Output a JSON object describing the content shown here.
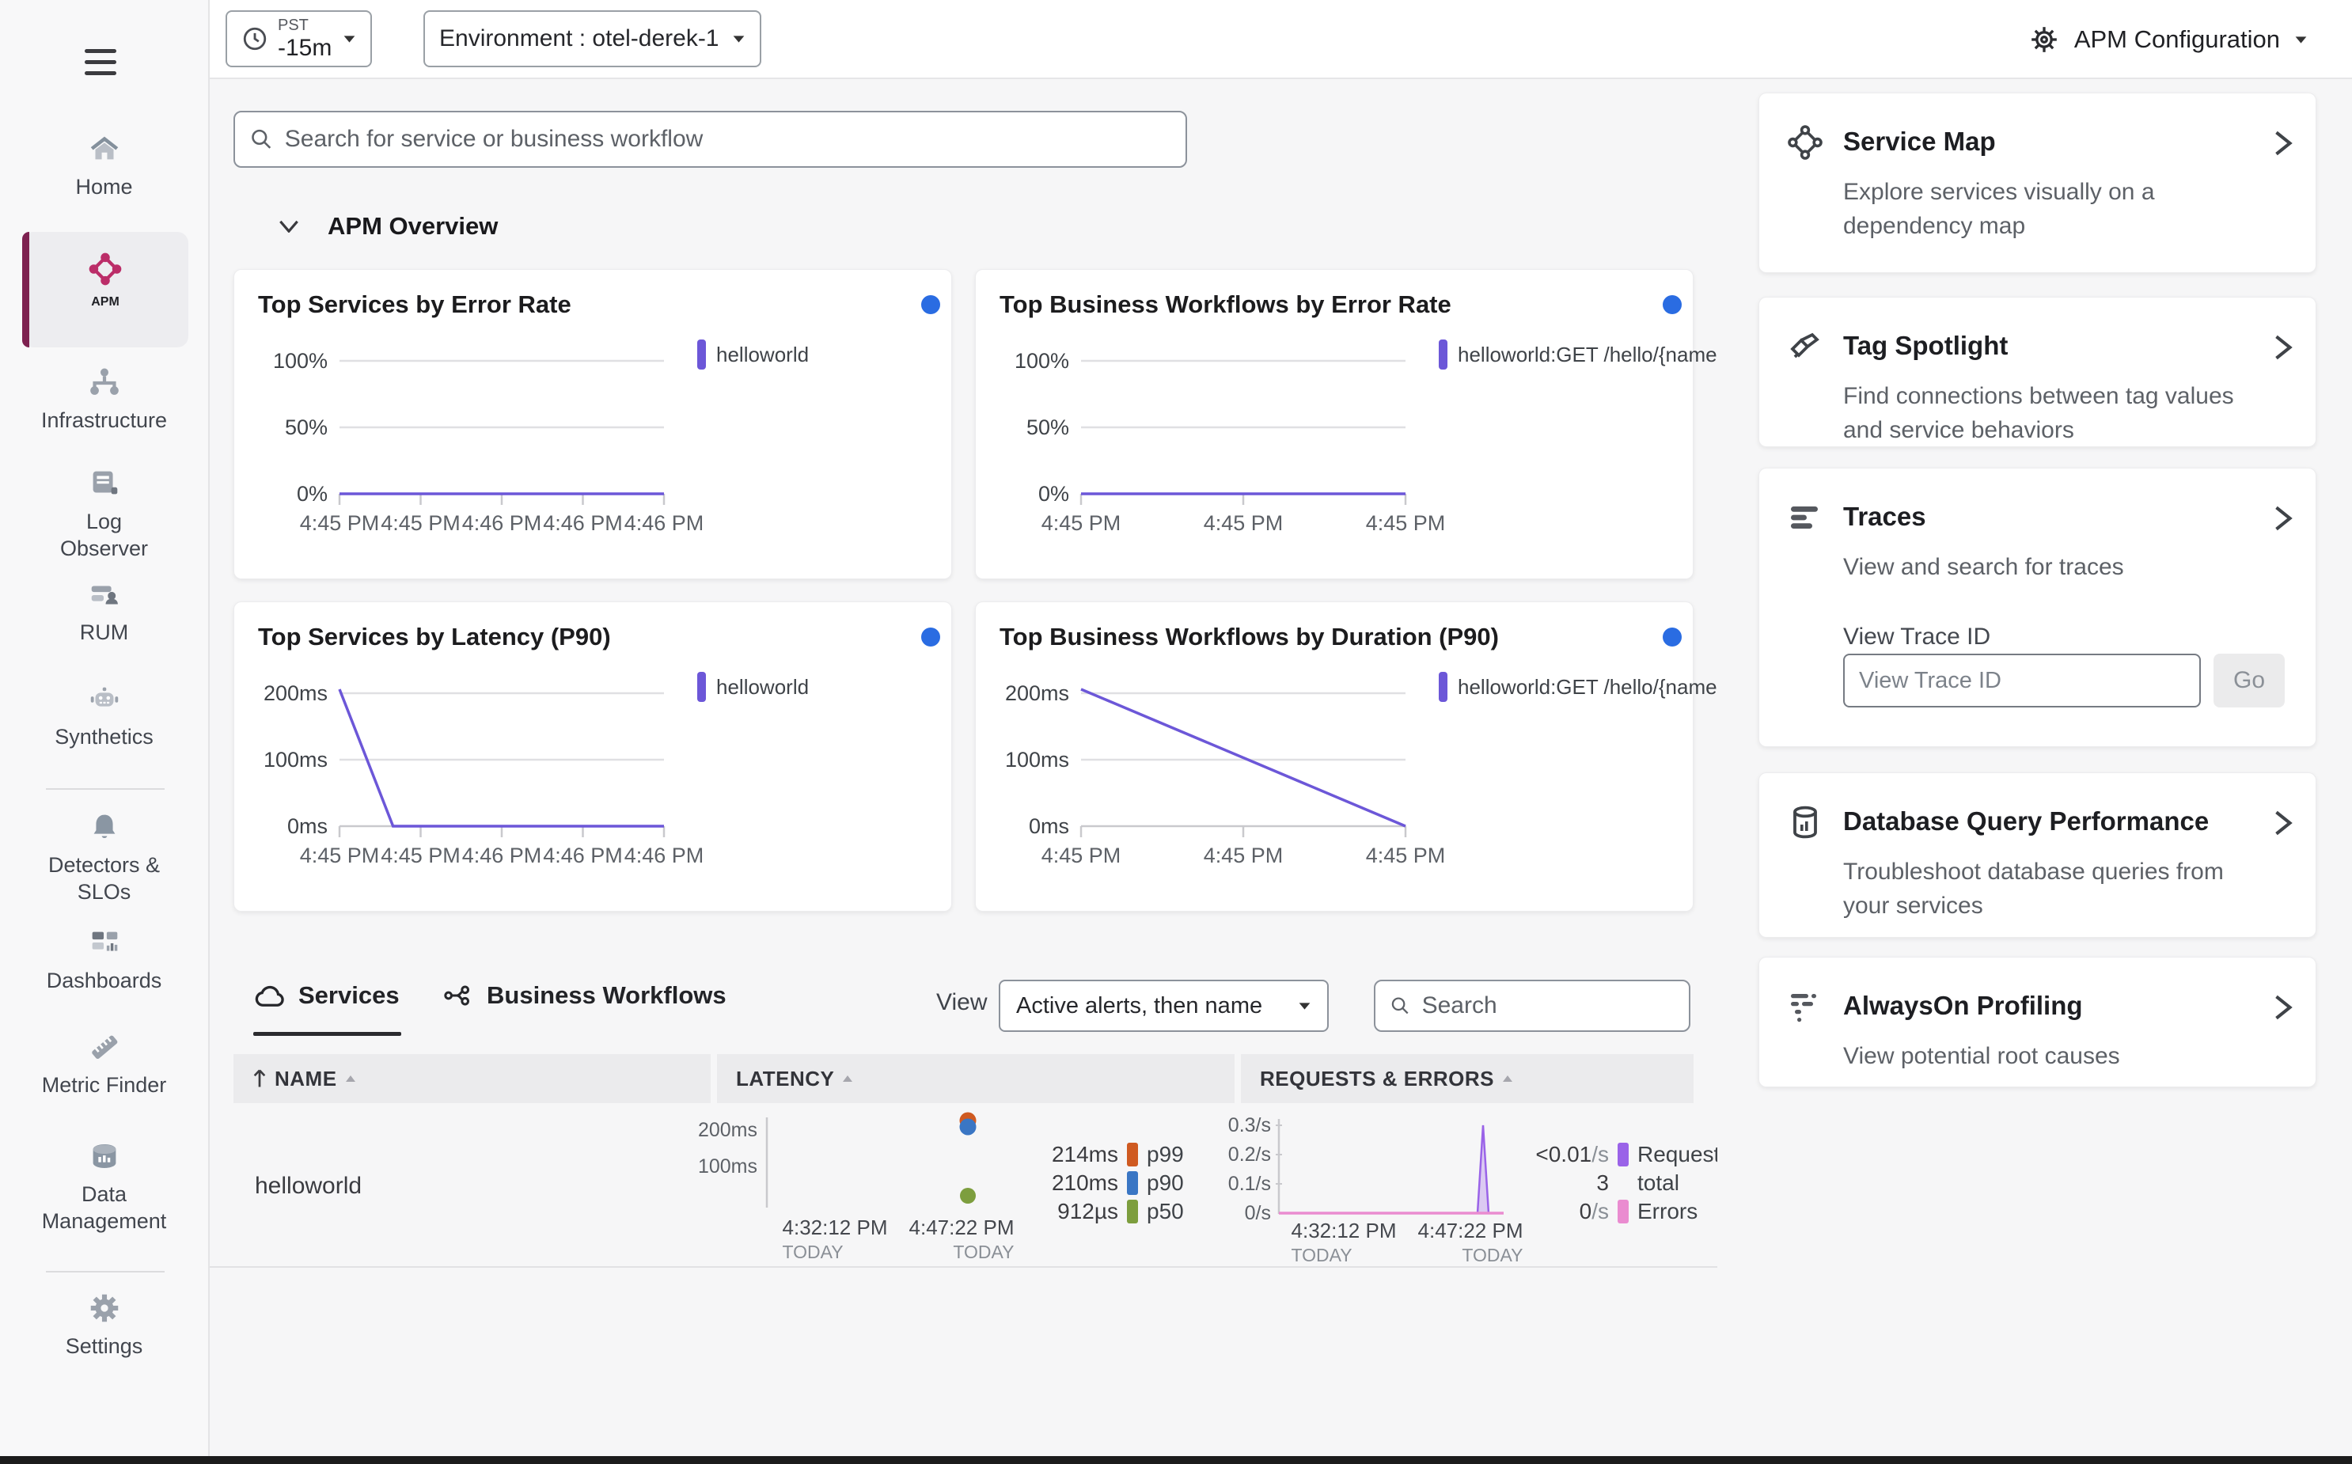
{
  "topbar": {
    "time_picker": {
      "timezone": "PST",
      "range": "-15m"
    },
    "environment": "Environment : otel-derek-1",
    "apm_configuration": "APM Configuration"
  },
  "sidebar": {
    "items": [
      {
        "label": "Home"
      },
      {
        "label": "APM",
        "active": true
      },
      {
        "label": "Infrastructure"
      },
      {
        "label": "Log Observer"
      },
      {
        "label": "RUM"
      },
      {
        "label": "Synthetics"
      },
      {
        "label": "Detectors & SLOs"
      },
      {
        "label": "Dashboards"
      },
      {
        "label": "Metric Finder"
      },
      {
        "label": "Data Management"
      },
      {
        "label": "Settings"
      }
    ],
    "active_color": "#bb2d68",
    "accent_color": "#7d2150"
  },
  "main": {
    "search_placeholder": "Search for service or business workflow",
    "section_title": "APM Overview"
  },
  "chart_data": [
    {
      "id": "top-services-by-error-rate",
      "type": "line",
      "title": "Top Services by Error Rate",
      "ylabel": "",
      "ylim": [
        0,
        100
      ],
      "grid": true,
      "legend_position": "right",
      "y_ticks": [
        "100%",
        "50%",
        "0%"
      ],
      "x_ticks": [
        "4:45 PM",
        "4:45 PM",
        "4:46 PM",
        "4:46 PM",
        "4:46 PM"
      ],
      "legend": [
        {
          "label": "helloworld",
          "color": "#6c57d8"
        }
      ],
      "series": [
        {
          "name": "helloworld",
          "color": "#6c57d8",
          "points": [
            [
              0,
              0
            ],
            [
              1,
              0
            ]
          ]
        }
      ]
    },
    {
      "id": "top-business-workflows-by-error-rate",
      "type": "line",
      "title": "Top Business Workflows by Error Rate",
      "ylabel": "",
      "ylim": [
        0,
        100
      ],
      "grid": true,
      "legend_position": "right",
      "y_ticks": [
        "100%",
        "50%",
        "0%"
      ],
      "x_ticks": [
        "4:45 PM",
        "4:45 PM",
        "4:45 PM"
      ],
      "legend": [
        {
          "label": "helloworld:GET /hello/{name?}",
          "color": "#6c57d8"
        }
      ],
      "series": [
        {
          "name": "helloworld:GET /hello/{name?}",
          "color": "#6c57d8",
          "points": [
            [
              0,
              0
            ],
            [
              1,
              0
            ]
          ]
        }
      ]
    },
    {
      "id": "top-services-by-latency-p90",
      "type": "line",
      "title": "Top Services by Latency (P90)",
      "ylabel": "",
      "ylim": [
        0,
        200
      ],
      "grid": true,
      "legend_position": "right",
      "y_ticks": [
        "200ms",
        "100ms",
        "0ms"
      ],
      "x_ticks": [
        "4:45 PM",
        "4:45 PM",
        "4:46 PM",
        "4:46 PM",
        "4:46 PM"
      ],
      "legend": [
        {
          "label": "helloworld",
          "color": "#6c57d8"
        }
      ],
      "series": [
        {
          "name": "helloworld",
          "color": "#6c57d8",
          "points": [
            [
              0,
              1.03
            ],
            [
              0.165,
              0
            ],
            [
              1,
              0
            ]
          ]
        }
      ]
    },
    {
      "id": "top-business-workflows-by-duration-p90",
      "type": "line",
      "title": "Top Business Workflows by Duration (P90)",
      "ylabel": "",
      "ylim": [
        0,
        200
      ],
      "grid": true,
      "legend_position": "right",
      "y_ticks": [
        "200ms",
        "100ms",
        "0ms"
      ],
      "x_ticks": [
        "4:45 PM",
        "4:45 PM",
        "4:45 PM"
      ],
      "legend": [
        {
          "label": "helloworld:GET /hello/{name?}",
          "color": "#6c57d8"
        }
      ],
      "series": [
        {
          "name": "helloworld:GET /hello/{name?}",
          "color": "#6c57d8",
          "points": [
            [
              0,
              1.03
            ],
            [
              1,
              0
            ]
          ]
        }
      ]
    }
  ],
  "table": {
    "tabs": [
      {
        "label": "Services",
        "active": true
      },
      {
        "label": "Business Workflows",
        "active": false
      }
    ],
    "view_label": "View",
    "view_value": "Active alerts, then name",
    "search_placeholder": "Search",
    "columns": [
      "NAME",
      "LATENCY",
      "REQUESTS & ERRORS"
    ],
    "rows": [
      {
        "name": "helloworld",
        "latency": {
          "y_ticks": [
            "200ms",
            "100ms"
          ],
          "x_ticks": [
            "4:32:12 PM",
            "4:47:22 PM"
          ],
          "x_sub": "TODAY",
          "values": [
            {
              "value": "214ms",
              "label": "p99",
              "color": "#cf5a21"
            },
            {
              "value": "210ms",
              "label": "p90",
              "color": "#3a76c4"
            },
            {
              "value": "912µs",
              "label": "p50",
              "color": "#7d9e3e"
            }
          ]
        },
        "requests": {
          "y_ticks": [
            "0.3/s",
            "0.2/s",
            "0.1/s",
            "0/s"
          ],
          "x_ticks": [
            "4:32:12 PM",
            "4:47:22 PM"
          ],
          "x_sub": "TODAY",
          "requests_color": "#9a63e8",
          "errors_color": "#ea8cd0",
          "stats": [
            {
              "value": "<0.01",
              "unit": "/s",
              "label": "Requests",
              "color": "#9a63e8"
            },
            {
              "value": "3",
              "unit": "",
              "label": "total",
              "color": ""
            },
            {
              "value": "0",
              "unit": "/s",
              "label": "Errors",
              "color": "#ea8cd0"
            }
          ]
        }
      }
    ]
  },
  "right_panel": {
    "cards": [
      {
        "title": "Service Map",
        "desc": "Explore services visually on a dependency map"
      },
      {
        "title": "Tag Spotlight",
        "desc": "Find connections between tag values and service behaviors"
      },
      {
        "title": "Traces",
        "desc": "View and search for traces",
        "trace_label": "View Trace ID",
        "trace_placeholder": "View Trace ID",
        "go_label": "Go"
      },
      {
        "title": "Database Query Performance",
        "desc": "Troubleshoot database queries from your services"
      },
      {
        "title": "AlwaysOn Profiling",
        "desc": "View potential root causes"
      }
    ]
  }
}
